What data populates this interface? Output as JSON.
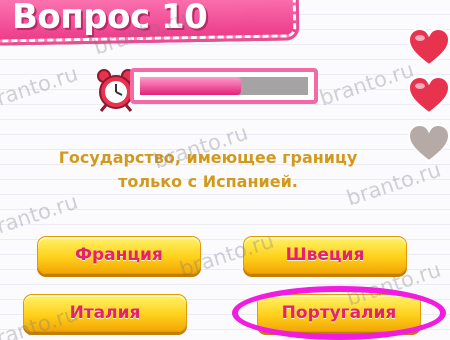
{
  "header": {
    "title": "Вопрос 10"
  },
  "timer": {
    "remaining_fraction": 0.6
  },
  "lives": {
    "total": 3,
    "remaining": 2,
    "full_color": "#e8334f",
    "empty_color": "#b5aaa6"
  },
  "question": {
    "line1": "Государство, имеющее границу",
    "line2": "только с Испанией."
  },
  "answers": [
    {
      "label": "Франция"
    },
    {
      "label": "Швеция"
    },
    {
      "label": "Италия"
    },
    {
      "label": "Португалия"
    }
  ],
  "highlighted_answer": "Португалия",
  "watermark": "branto.ru",
  "colors": {
    "accent": "#ec3d8b",
    "question_text": "#d29a1c",
    "answer_text": "#e2236f",
    "button": "#ffd11c",
    "highlight": "#f21be0"
  }
}
